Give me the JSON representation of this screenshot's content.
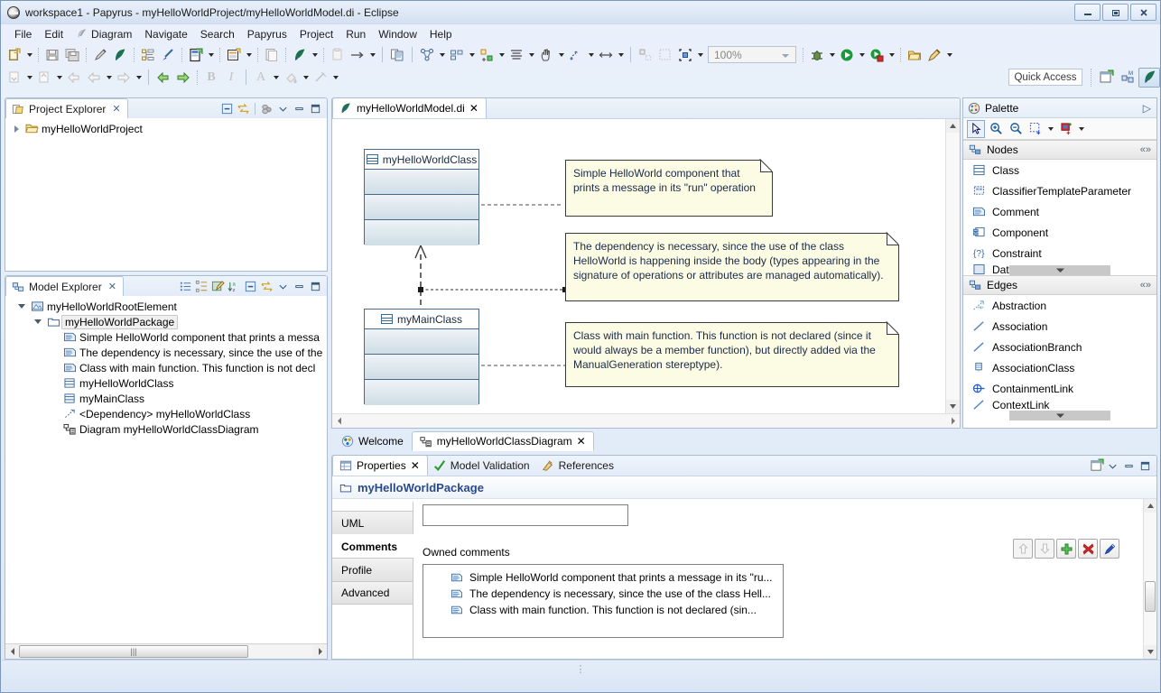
{
  "window": {
    "title": "workspace1 - Papyrus - myHelloWorldProject/myHelloWorldModel.di - Eclipse",
    "app_icon": "eclipse-icon",
    "buttons": {
      "minimize": "minimize-button",
      "maximize": "maximize-button",
      "close": "close-button"
    }
  },
  "menubar": {
    "items": [
      {
        "label": "File"
      },
      {
        "label": "Edit"
      },
      {
        "label": "Diagram",
        "icon": "papyrus-icon"
      },
      {
        "label": "Navigate"
      },
      {
        "label": "Search"
      },
      {
        "label": "Papyrus"
      },
      {
        "label": "Project"
      },
      {
        "label": "Run"
      },
      {
        "label": "Window"
      },
      {
        "label": "Help"
      }
    ]
  },
  "toolbar": {
    "zoom_value": "100%",
    "quick_access": "Quick Access"
  },
  "project_explorer": {
    "title": "Project Explorer",
    "icon": "project-explorer-icon",
    "tree": [
      {
        "label": "myHelloWorldProject",
        "icon": "folder-open-icon",
        "expanded": false,
        "level": 0
      }
    ]
  },
  "model_explorer": {
    "title": "Model Explorer",
    "icon": "model-explorer-icon",
    "tree": [
      {
        "label": "myHelloWorldRootElement",
        "icon": "model-icon",
        "expanded": true,
        "level": 0,
        "selected": false
      },
      {
        "label": "myHelloWorldPackage",
        "icon": "package-icon",
        "expanded": true,
        "level": 1,
        "selected": true
      },
      {
        "label": "Simple HelloWorld component that prints a messa",
        "icon": "comment-icon",
        "level": 2,
        "selected": false
      },
      {
        "label": "The dependency is necessary, since the use of the",
        "icon": "comment-icon",
        "level": 2,
        "selected": false
      },
      {
        "label": "Class with main function. This function is not decl",
        "icon": "comment-icon",
        "level": 2,
        "selected": false
      },
      {
        "label": "myHelloWorldClass",
        "icon": "class-icon",
        "level": 2,
        "selected": false
      },
      {
        "label": "myMainClass",
        "icon": "class-icon",
        "level": 2,
        "selected": false
      },
      {
        "label": "<Dependency> myHelloWorldClass",
        "icon": "dependency-icon",
        "level": 2,
        "selected": false
      },
      {
        "label": "Diagram myHelloWorldClassDiagram",
        "icon": "diagram-icon",
        "level": 2,
        "selected": false
      }
    ]
  },
  "editor": {
    "tab_label": "myHelloWorldModel.di",
    "tab_icon": "papyrus-icon",
    "diagram": {
      "classes": [
        {
          "name": "myHelloWorldClass",
          "icon": "class-icon"
        },
        {
          "name": "myMainClass",
          "icon": "class-icon"
        }
      ],
      "notes": [
        {
          "text": "Simple HelloWorld component that prints a message in its \"run\" operation"
        },
        {
          "text": "The dependency is necessary, since the use of the class HelloWorld is happening inside the body (types appearing in the signature of operations or attributes are managed automatically)."
        },
        {
          "text": "Class with main function. This function is not declared (since it would always be a member function), but directly added via the ManualGeneration stereptype)."
        }
      ]
    },
    "bottom_tabs": [
      {
        "label": "Welcome",
        "icon": "welcome-icon",
        "active": false,
        "closable": false
      },
      {
        "label": "myHelloWorldClassDiagram",
        "icon": "diagram-icon",
        "active": true,
        "closable": true
      }
    ]
  },
  "palette": {
    "title": "Palette",
    "icon": "palette-icon",
    "tools": [
      "select-tool",
      "zoom-in-tool",
      "zoom-out-tool",
      "marquee-tool",
      "format-tool"
    ],
    "sections": [
      {
        "name": "Nodes",
        "icon": "nodes-icon",
        "items": [
          {
            "label": "Class",
            "icon": "class-icon"
          },
          {
            "label": "ClassifierTemplateParameter",
            "icon": "classifier-template-parameter-icon"
          },
          {
            "label": "Comment",
            "icon": "comment-icon"
          },
          {
            "label": "Component",
            "icon": "component-icon"
          },
          {
            "label": "Constraint",
            "icon": "constraint-icon"
          },
          {
            "label": "DataType",
            "icon": "datatype-icon"
          }
        ]
      },
      {
        "name": "Edges",
        "icon": "edges-icon",
        "items": [
          {
            "label": "Abstraction",
            "icon": "abstraction-icon"
          },
          {
            "label": "Association",
            "icon": "association-icon"
          },
          {
            "label": "AssociationBranch",
            "icon": "association-branch-icon"
          },
          {
            "label": "AssociationClass",
            "icon": "association-class-icon"
          },
          {
            "label": "ContainmentLink",
            "icon": "containment-link-icon"
          },
          {
            "label": "ContextLink",
            "icon": "context-link-icon"
          }
        ]
      }
    ]
  },
  "properties": {
    "tabs": [
      {
        "label": "Properties",
        "icon": "properties-icon",
        "active": true,
        "closable": true
      },
      {
        "label": "Model Validation",
        "icon": "validation-check-icon",
        "active": false,
        "closable": false
      },
      {
        "label": "References",
        "icon": "references-icon",
        "active": false,
        "closable": false
      }
    ],
    "selected_element": "myHelloWorldPackage",
    "selected_element_icon": "package-icon",
    "side_tabs": [
      {
        "label": "UML",
        "active": false
      },
      {
        "label": "Comments",
        "active": true
      },
      {
        "label": "Profile",
        "active": false
      },
      {
        "label": "Advanced",
        "active": false
      }
    ],
    "owned_comments_label": "Owned comments",
    "action_buttons": [
      {
        "name": "move-up-button",
        "glyph": "⇧",
        "disabled": true
      },
      {
        "name": "move-down-button",
        "glyph": "⇩",
        "disabled": true
      },
      {
        "name": "add-comment-button",
        "glyph": "+",
        "disabled": false
      },
      {
        "name": "delete-comment-button",
        "glyph": "✖",
        "disabled": false
      },
      {
        "name": "edit-comment-button",
        "glyph": "✎",
        "disabled": false
      }
    ],
    "owned_comments": [
      {
        "label": "Simple HelloWorld component that prints a message in its \"ru...",
        "icon": "comment-icon"
      },
      {
        "label": "The dependency is necessary, since the use of the class Hell...",
        "icon": "comment-icon"
      },
      {
        "label": "Class with main function. This function is not declared (sin...",
        "icon": "comment-icon"
      }
    ]
  },
  "colors": {
    "accent": "#2a4a8a",
    "note_bg": "#fcfbe3",
    "class_compartment": "#cfdde6",
    "chrome": "#dae6f5"
  }
}
